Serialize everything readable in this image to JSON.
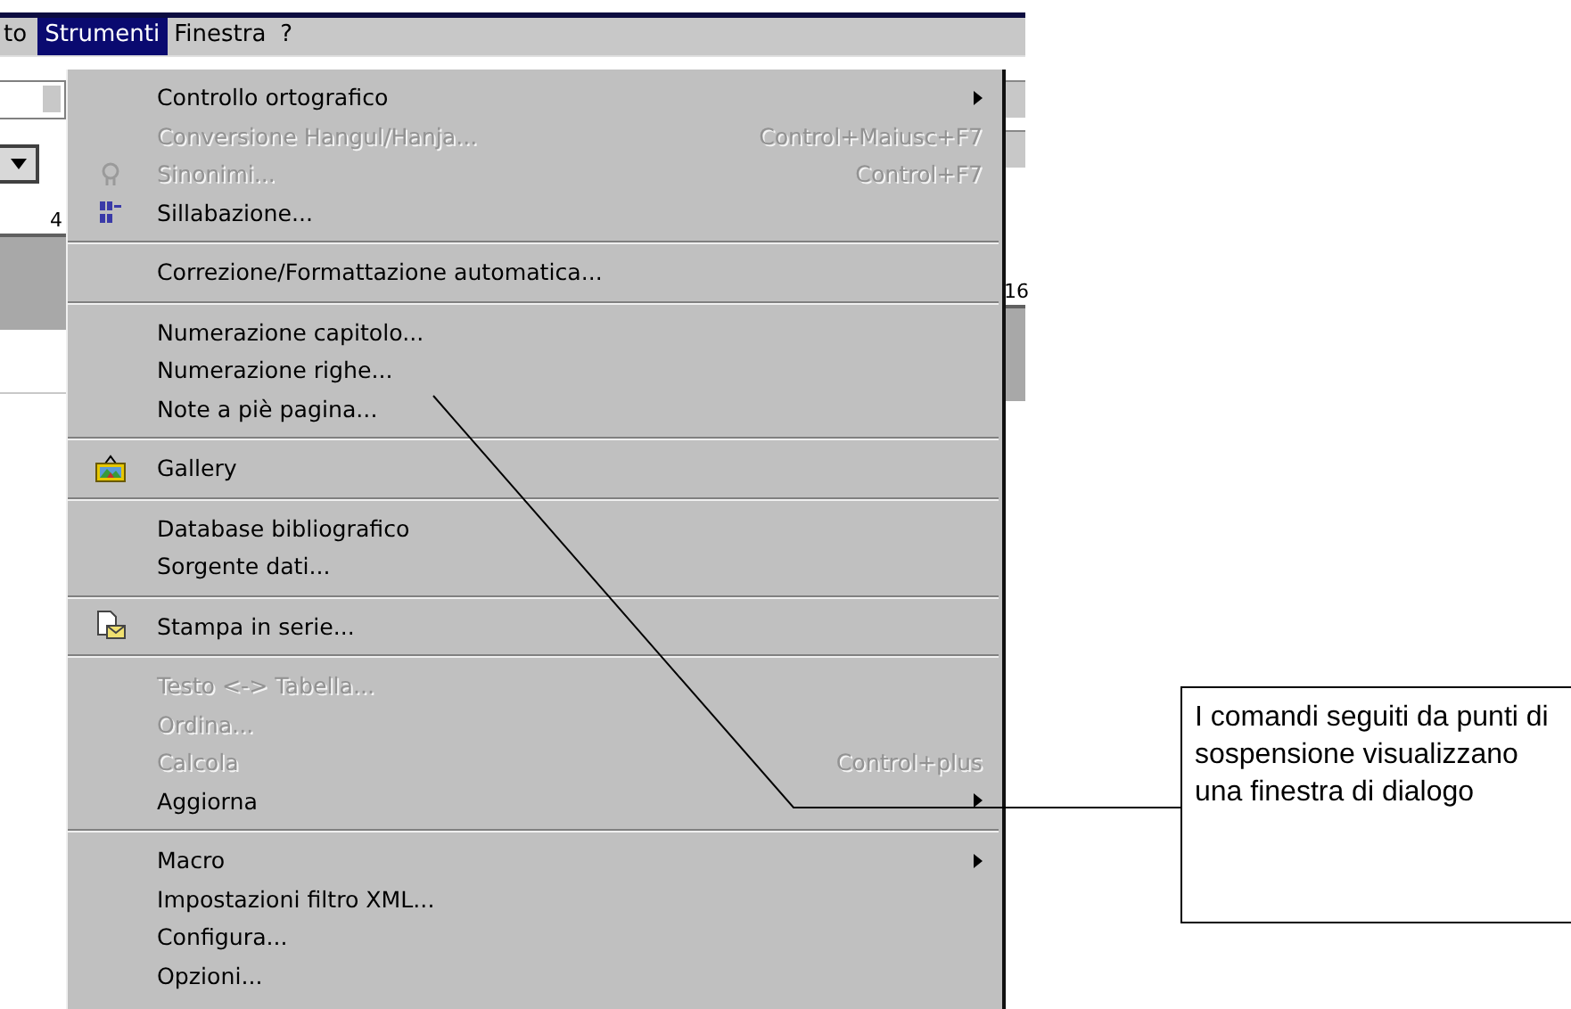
{
  "menubar": [
    {
      "label": "to",
      "selected": false
    },
    {
      "label": "Strumenti",
      "selected": true
    },
    {
      "label": "Finestra",
      "selected": false
    },
    {
      "label": "?",
      "selected": false
    }
  ],
  "ruler": {
    "labels": [
      "4",
      "16"
    ]
  },
  "menu": {
    "items": [
      {
        "kind": "item",
        "label": "Controllo ortografico",
        "disabled": false,
        "submenu": true
      },
      {
        "kind": "item",
        "label": "Conversione Hangul/Hanja...",
        "disabled": true,
        "shortcut": "Control+Maiusc+F7"
      },
      {
        "kind": "item",
        "label": "Sinonimi...",
        "disabled": true,
        "shortcut": "Control+F7",
        "icon": true
      },
      {
        "kind": "item",
        "label": "Sillabazione...",
        "disabled": false,
        "icon": true
      },
      {
        "kind": "separator"
      },
      {
        "kind": "item",
        "label": "Correzione/Formattazione automatica...",
        "disabled": false
      },
      {
        "kind": "separator"
      },
      {
        "kind": "item",
        "label": "Numerazione capitolo...",
        "disabled": false
      },
      {
        "kind": "item",
        "label": "Numerazione righe...",
        "disabled": false
      },
      {
        "kind": "item",
        "label": "Note a piè pagina...",
        "disabled": false
      },
      {
        "kind": "separator"
      },
      {
        "kind": "item",
        "label": "Gallery",
        "disabled": false,
        "icon": true
      },
      {
        "kind": "separator"
      },
      {
        "kind": "item",
        "label": "Database bibliografico",
        "disabled": false
      },
      {
        "kind": "item",
        "label": "Sorgente dati...",
        "disabled": false
      },
      {
        "kind": "separator"
      },
      {
        "kind": "item",
        "label": "Stampa in serie...",
        "disabled": false,
        "icon": true
      },
      {
        "kind": "separator"
      },
      {
        "kind": "item",
        "label": "Testo <-> Tabella...",
        "disabled": true
      },
      {
        "kind": "item",
        "label": "Ordina...",
        "disabled": true
      },
      {
        "kind": "item",
        "label": "Calcola",
        "disabled": true,
        "shortcut": "Control+plus"
      },
      {
        "kind": "item",
        "label": "Aggiorna",
        "disabled": false,
        "submenu": true
      },
      {
        "kind": "separator"
      },
      {
        "kind": "item",
        "label": "Macro",
        "disabled": false,
        "submenu": true
      },
      {
        "kind": "item",
        "label": "Impostazioni filtro XML...",
        "disabled": false
      },
      {
        "kind": "item",
        "label": "Configura...",
        "disabled": false
      },
      {
        "kind": "item",
        "label": "Opzioni...",
        "disabled": false
      }
    ]
  },
  "callout": {
    "text": "I comandi seguiti da punti di sospensione visualizzano una finestra di dialogo"
  }
}
